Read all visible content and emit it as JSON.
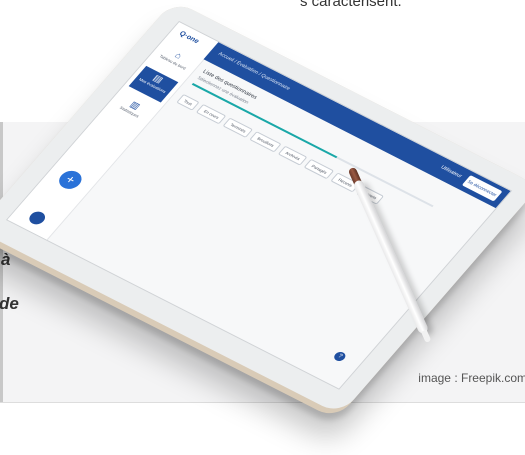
{
  "page": {
    "top_text": "s caractérisent.",
    "quote_lines": [
      "à",
      "de"
    ],
    "image_credit": "image : Freepik.com"
  },
  "app": {
    "logo": "Q·one",
    "nav_items": [
      {
        "label": "Tableau de bord",
        "icon": "home-icon"
      },
      {
        "label": "Mes évaluations",
        "icon": "clipboard-icon",
        "active": true
      },
      {
        "label": "Statistiques",
        "icon": "chart-icon"
      }
    ],
    "fab_icon": "plus-icon",
    "breadcrumb": "Accueil / Évaluation / Questionnaire",
    "user_chip": "Utilisateur",
    "appbar_button": "Se déconnecter",
    "page_title": "Liste des questionnaires",
    "page_subtitle": "Sélectionnez une évaluation",
    "progress_fraction": 0.6,
    "filter_chips": [
      "Tous",
      "En cours",
      "Terminés",
      "Brouillons",
      "Archivés",
      "Partagés",
      "Récents",
      "Favoris"
    ],
    "help_icon": "help-icon"
  },
  "colors": {
    "accent": "#1f4fa0",
    "progress": "#19a8a8",
    "fab": "#2a72d8",
    "band": "#f4f4f5"
  }
}
